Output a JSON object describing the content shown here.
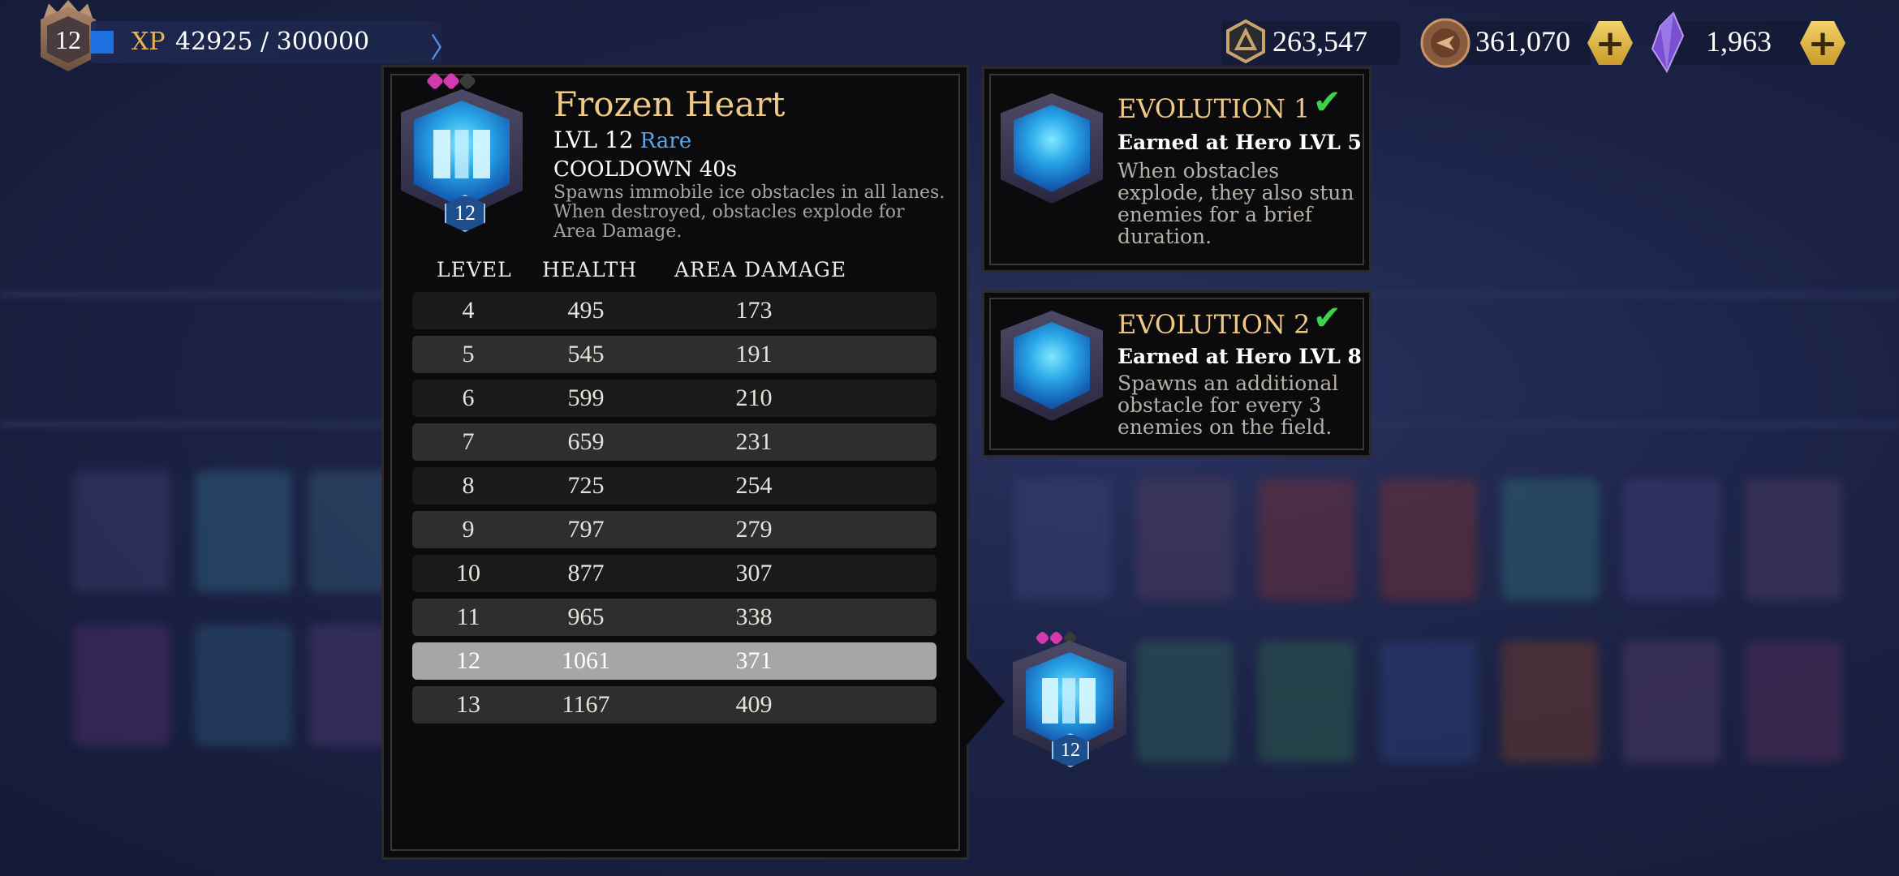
{
  "player": {
    "level": "12",
    "xp_label": "XP",
    "xp_value": "42925 / 300000",
    "xp_current": 42925,
    "xp_max": 300000
  },
  "currencies": [
    {
      "name": "gold-emblem",
      "icon": "hex-token-icon",
      "value": "263,547"
    },
    {
      "name": "coins",
      "icon": "coin-icon",
      "value": "361,070"
    },
    {
      "name": "gems",
      "icon": "crystal-icon",
      "value": "1,963"
    }
  ],
  "plus_label": "+",
  "card": {
    "name": "Frozen Heart",
    "level_text": "LVL 12",
    "rarity": "Rare",
    "cooldown": "COOLDOWN 40s",
    "description": "Spawns immobile ice obstacles in all lanes. When destroyed, obstacles explode for Area Damage.",
    "badge_level": "12"
  },
  "table": {
    "headers": [
      "LEVEL",
      "HEALTH",
      "AREA DAMAGE"
    ],
    "rows": [
      [
        "4",
        "495",
        "173"
      ],
      [
        "5",
        "545",
        "191"
      ],
      [
        "6",
        "599",
        "210"
      ],
      [
        "7",
        "659",
        "231"
      ],
      [
        "8",
        "725",
        "254"
      ],
      [
        "9",
        "797",
        "279"
      ],
      [
        "10",
        "877",
        "307"
      ],
      [
        "11",
        "965",
        "338"
      ],
      [
        "12",
        "1061",
        "371"
      ],
      [
        "13",
        "1167",
        "409"
      ]
    ],
    "selected_level": "12"
  },
  "evolutions": [
    {
      "title": "EVOLUTION 1",
      "earned": "Earned at Hero LVL 5",
      "description": "When obstacles explode, they also stun enemies for a brief duration.",
      "completed": true
    },
    {
      "title": "EVOLUTION 2",
      "earned": "Earned at Hero LVL 8",
      "description": "Spawns an additional obstacle for every 3 enemies on the field.",
      "completed": true
    }
  ],
  "check_glyph": "✔",
  "selected_card_badge": "12",
  "colors": {
    "title_gold": "#f0c987",
    "rarity_blue": "#5aa7e8",
    "check_green": "#3cd34a",
    "xp_gold": "#e6b34f"
  }
}
